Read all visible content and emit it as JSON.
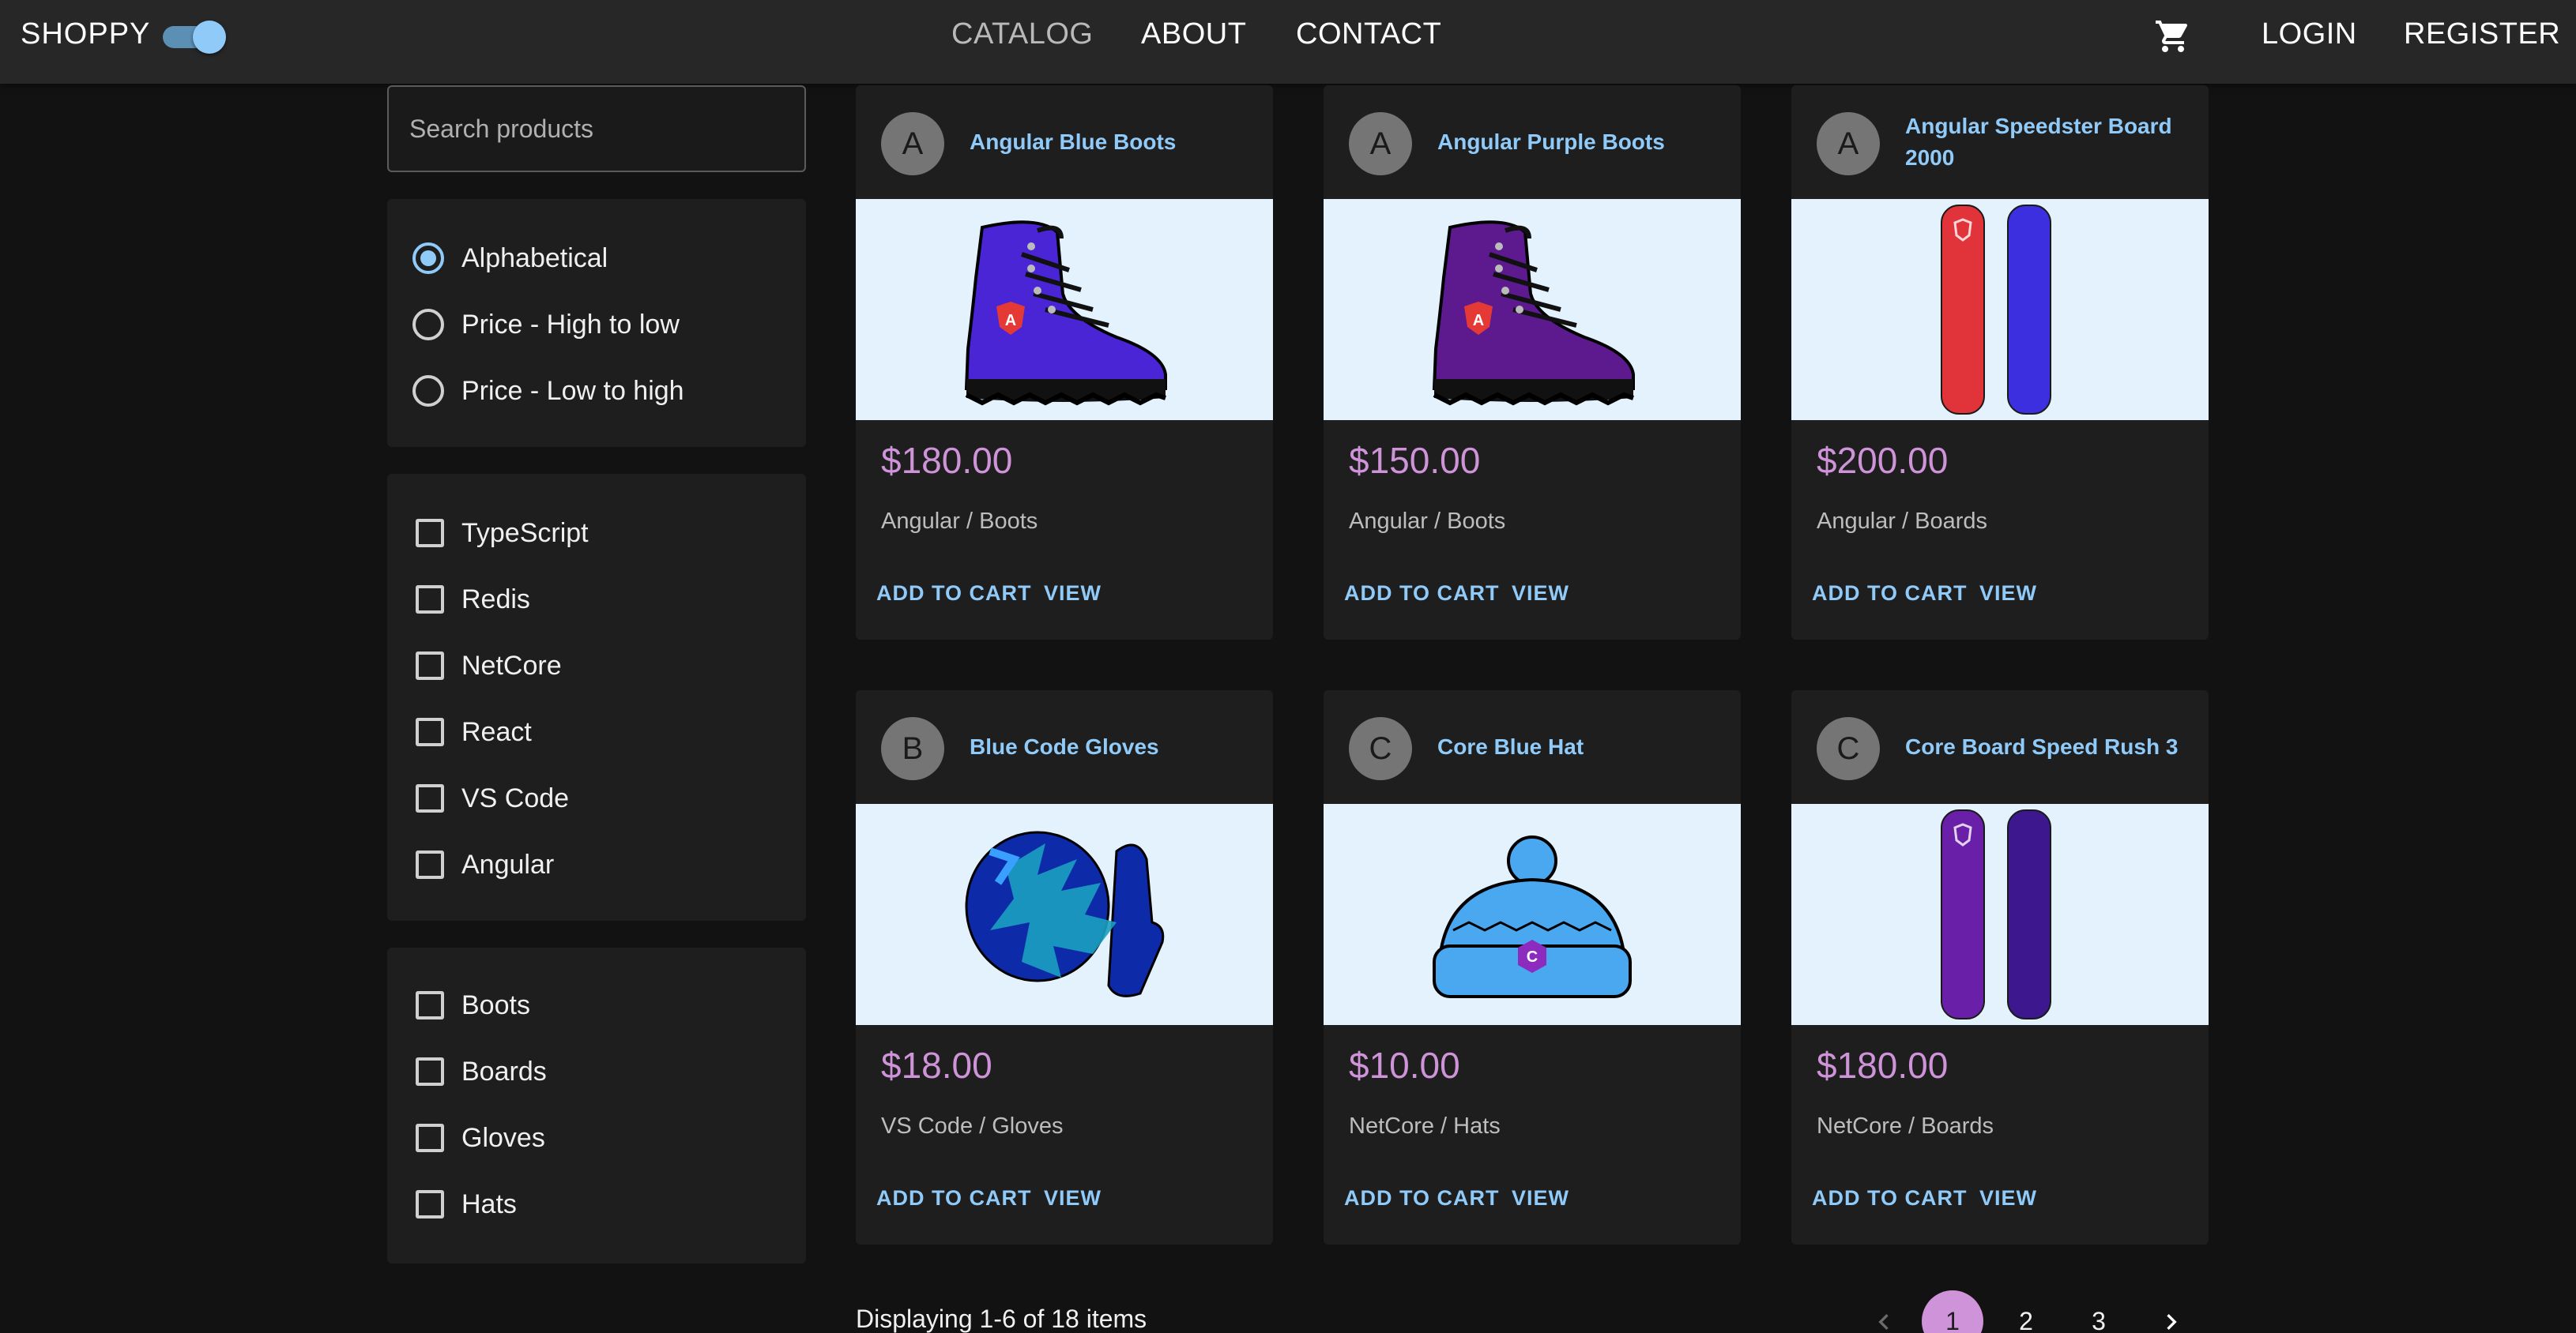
{
  "header": {
    "brand": "SHOPPY",
    "theme_toggle_on": true,
    "nav": {
      "catalog": "CATALOG",
      "about": "ABOUT",
      "contact": "CONTACT"
    },
    "cart_icon": "shopping-cart-icon",
    "login": "LOGIN",
    "register": "REGISTER"
  },
  "sidebar": {
    "search_placeholder": "Search products",
    "sort": [
      {
        "label": "Alphabetical",
        "selected": true
      },
      {
        "label": "Price - High to low",
        "selected": false
      },
      {
        "label": "Price - Low to high",
        "selected": false
      }
    ],
    "tech": [
      "TypeScript",
      "Redis",
      "NetCore",
      "React",
      "VS Code",
      "Angular"
    ],
    "categories": [
      "Boots",
      "Boards",
      "Gloves",
      "Hats"
    ]
  },
  "products": [
    {
      "avatar": "A",
      "title": "Angular Blue Boots",
      "price": "$180.00",
      "meta": "Angular / Boots",
      "add": "ADD TO CART",
      "view": "VIEW",
      "image": "boot",
      "color": "#4a25d6",
      "logo": "#e53935"
    },
    {
      "avatar": "A",
      "title": "Angular Purple Boots",
      "price": "$150.00",
      "meta": "Angular / Boots",
      "add": "ADD TO CART",
      "view": "VIEW",
      "image": "boot",
      "color": "#5c1a8e",
      "logo": "#e53935"
    },
    {
      "avatar": "A",
      "title": "Angular Speedster Board 2000",
      "price": "$200.00",
      "meta": "Angular / Boards",
      "add": "ADD TO CART",
      "view": "VIEW",
      "image": "boards",
      "color": "#e0343a",
      "color2": "#3b2fe0"
    },
    {
      "avatar": "B",
      "title": "Blue Code Gloves",
      "price": "$18.00",
      "meta": "VS Code / Gloves",
      "add": "ADD TO CART",
      "view": "VIEW",
      "image": "gloves",
      "color": "#0d2aa8"
    },
    {
      "avatar": "C",
      "title": "Core Blue Hat",
      "price": "$10.00",
      "meta": "NetCore / Hats",
      "add": "ADD TO CART",
      "view": "VIEW",
      "image": "hat",
      "color": "#4aa8f0"
    },
    {
      "avatar": "C",
      "title": "Core Board Speed Rush 3",
      "price": "$180.00",
      "meta": "NetCore / Boards",
      "add": "ADD TO CART",
      "view": "VIEW",
      "image": "boards",
      "color": "#6a1fa8",
      "color2": "#3c178e"
    }
  ],
  "footer": {
    "display_text": "Displaying 1-6 of 18 items",
    "pages": [
      "1",
      "2",
      "3"
    ],
    "active_page": "1"
  },
  "colors": {
    "accent": "#90caf9",
    "price": "#ce93d8",
    "background": "#121212",
    "card": "#1e1e1e"
  }
}
